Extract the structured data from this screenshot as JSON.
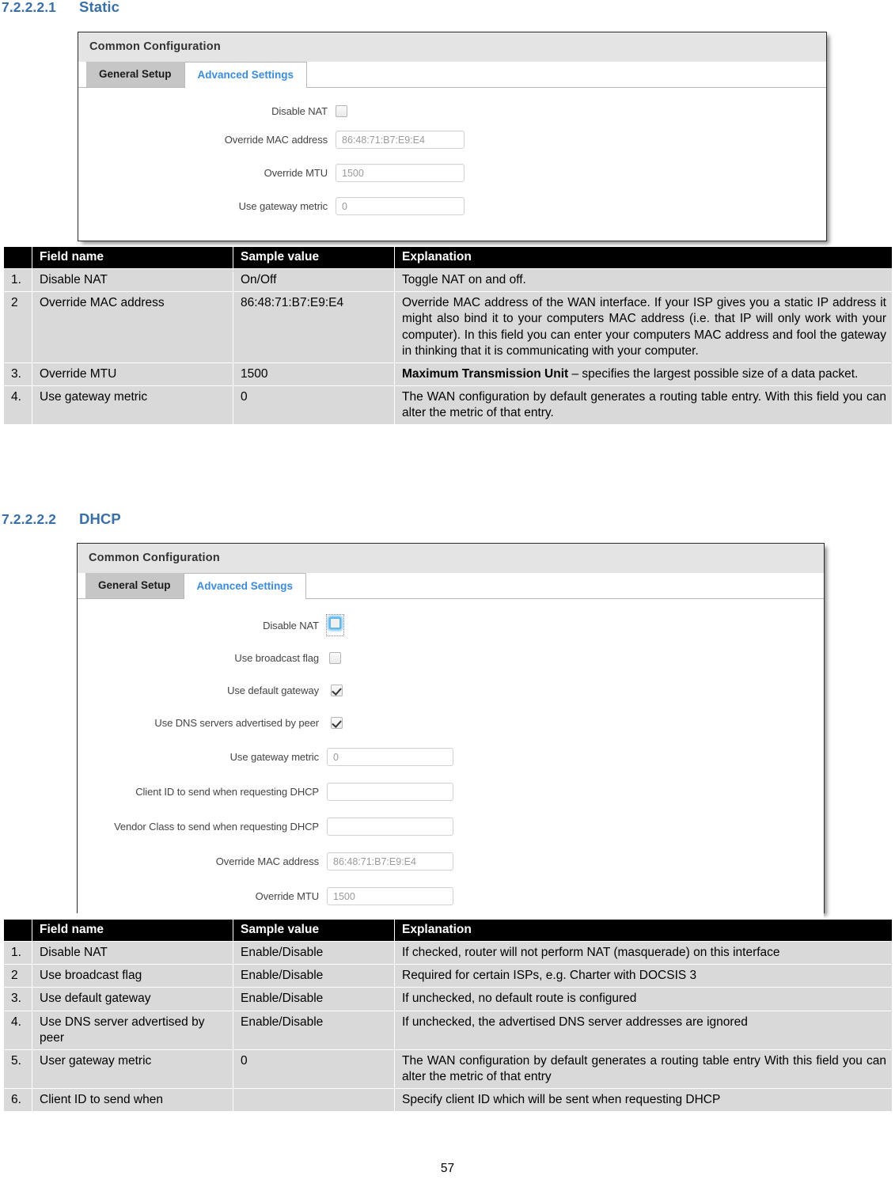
{
  "sections": [
    {
      "number": "7.2.2.2.1",
      "title": "Static",
      "panel": {
        "title": "Common Configuration",
        "tabs": [
          {
            "label": "General Setup",
            "state": "inactive"
          },
          {
            "label": "Advanced Settings",
            "state": "active"
          }
        ],
        "fields": [
          {
            "label": "Disable NAT",
            "type": "checkbox",
            "checked": false,
            "focused": false
          },
          {
            "label": "Override MAC address",
            "type": "text",
            "value": "86:48:71:B7:E9:E4"
          },
          {
            "label": "Override MTU",
            "type": "text",
            "value": "1500"
          },
          {
            "label": "Use gateway metric",
            "type": "text",
            "value": "0"
          }
        ]
      },
      "table": {
        "headers": [
          "",
          "Field name",
          "Sample value",
          "Explanation"
        ],
        "rows": [
          {
            "num": "1.",
            "field": "Disable NAT",
            "sample": "On/Off",
            "explanation": "Toggle NAT on and off."
          },
          {
            "num": "2",
            "field": "Override MAC address",
            "sample": "86:48:71:B7:E9:E4",
            "explanation": "Override MAC address of the WAN interface. If your ISP gives you a static IP address it might also bind it to your computers MAC address (i.e. that IP will only work with your computer). In this field you can enter your computers MAC address and fool the gateway in thinking that it is communicating with your computer."
          },
          {
            "num": "3.",
            "field": "Override MTU",
            "sample": "1500",
            "explanation_bold": "Maximum Transmission Unit",
            "explanation": " – specifies the largest possible size of a data packet."
          },
          {
            "num": "4.",
            "field": "Use gateway metric",
            "sample": "0",
            "explanation": "The WAN configuration by default generates a routing table entry. With this field you can alter the metric of that entry."
          }
        ]
      }
    },
    {
      "number": "7.2.2.2.2",
      "title": "DHCP",
      "panel": {
        "title": "Common Configuration",
        "tabs": [
          {
            "label": "General Setup",
            "state": "inactive"
          },
          {
            "label": "Advanced Settings",
            "state": "active"
          }
        ],
        "fields": [
          {
            "label": "Disable NAT",
            "type": "checkbox",
            "checked": false,
            "focused": true
          },
          {
            "label": "Use broadcast flag",
            "type": "checkbox",
            "checked": false,
            "focused": false
          },
          {
            "label": "Use default gateway",
            "type": "checkbox",
            "checked": true,
            "focused": false
          },
          {
            "label": "Use DNS servers advertised by peer",
            "type": "checkbox",
            "checked": true,
            "focused": false
          },
          {
            "label": "Use gateway metric",
            "type": "text",
            "value": "0"
          },
          {
            "label": "Client ID to send when requesting DHCP",
            "type": "text",
            "value": ""
          },
          {
            "label": "Vendor Class to send when requesting DHCP",
            "type": "text",
            "value": ""
          },
          {
            "label": "Override MAC address",
            "type": "text",
            "value": "86:48:71:B7:E9:E4"
          },
          {
            "label": "Override MTU",
            "type": "text",
            "value": "1500"
          }
        ]
      },
      "table": {
        "headers": [
          "",
          "Field name",
          "Sample value",
          "Explanation"
        ],
        "rows": [
          {
            "num": "1.",
            "field": "Disable NAT",
            "sample": "Enable/Disable",
            "explanation": "If checked, router will not perform NAT (masquerade) on this interface"
          },
          {
            "num": "2",
            "field": "Use broadcast flag",
            "sample": "Enable/Disable",
            "explanation": "Required for certain ISPs, e.g. Charter with DOCSIS 3"
          },
          {
            "num": "3.",
            "field": "Use default gateway",
            "sample": "Enable/Disable",
            "explanation": "If unchecked, no default route is configured"
          },
          {
            "num": "4.",
            "field": "Use DNS server advertised by peer",
            "sample": "Enable/Disable",
            "explanation": "If unchecked, the advertised DNS server addresses are ignored"
          },
          {
            "num": "5.",
            "field": "User gateway metric",
            "sample": "0",
            "explanation": "The WAN configuration by default generates a routing table entry With this field you can alter the metric of that entry"
          },
          {
            "num": "6.",
            "field": "Client ID to send when",
            "sample": "",
            "explanation": "Specify client ID which will be sent when requesting DHCP"
          }
        ]
      }
    }
  ],
  "page_number": "57",
  "colors": {
    "heading": "#3a6fa8",
    "tab_active_text": "#3b8cdb",
    "table_header_bg": "#000000",
    "table_row_bg": "#d9d9d9",
    "panel_title_bg": "#e4e4e4"
  }
}
